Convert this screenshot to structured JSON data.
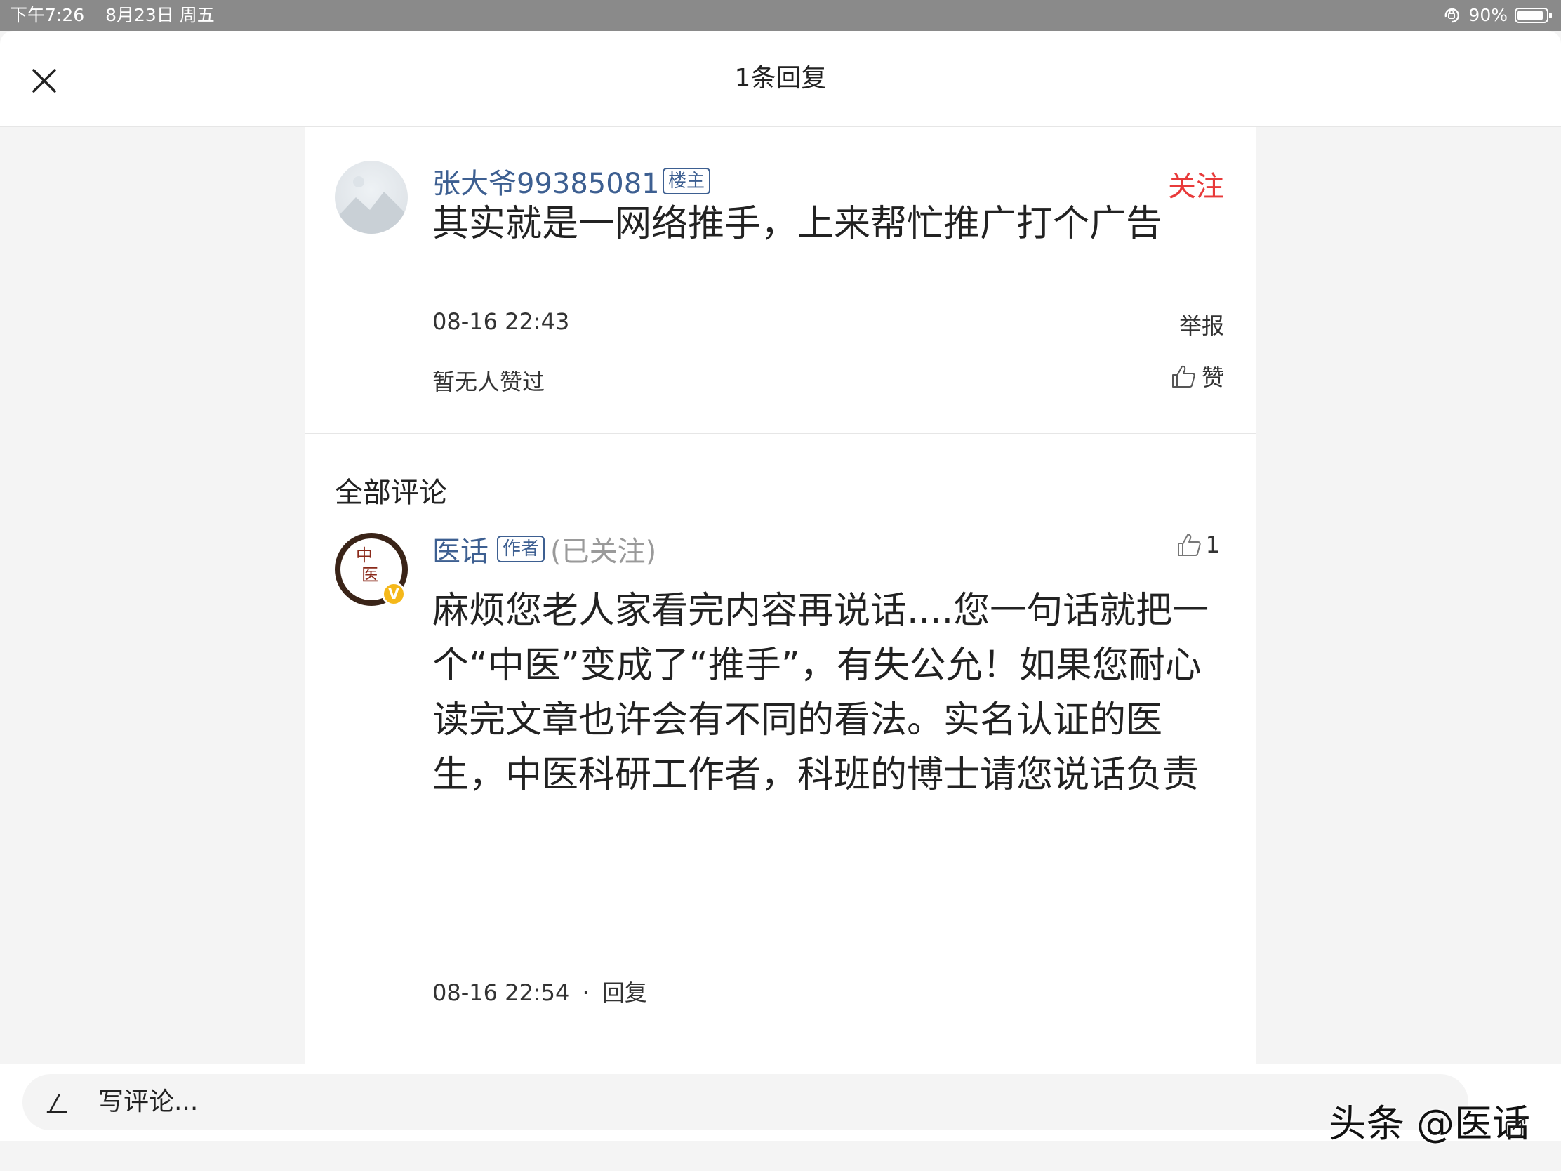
{
  "status_bar": {
    "time": "下午7:26",
    "date": "8月23日 周五",
    "battery": "90%",
    "battery_level": 0.9
  },
  "header": {
    "title": "1条回复"
  },
  "reply": {
    "username": "张大爷99385081",
    "badge": "楼主",
    "follow_label": "关注",
    "text": "其实就是一网络推手，上来帮忙推广打个广告",
    "timestamp": "08-16 22:43",
    "report_label": "举报",
    "no_likes_text": "暂无人赞过",
    "like_label": "赞"
  },
  "comments_section": {
    "title": "全部评论"
  },
  "comment": {
    "username": "医话",
    "badge": "作者",
    "follow_status": "(已关注)",
    "like_count": "1",
    "text": "麻烦您老人家看完内容再说话....您一句话就把一个“中医”变成了“推手”，有失公允！如果您耐心读完文章也许会有不同的看法。实名认证的医生，中医科研工作者，科班的博士请您说话负责",
    "timestamp": "08-16 22:54",
    "separator": "·",
    "reply_label": "回复",
    "avatar_text_top": "中",
    "avatar_text_bottom": "医",
    "verified_mark": "V"
  },
  "bottom_bar": {
    "placeholder": "写评论..."
  },
  "watermark": "头条 @医话",
  "colors": {
    "link_blue": "#3d5f91",
    "follow_red": "#e83a3a",
    "verified_gold": "#f5b81a"
  },
  "icons": [
    "close-icon",
    "thumbs-up-icon",
    "pen-icon",
    "rotation-lock-icon",
    "battery-icon",
    "share-icon"
  ]
}
